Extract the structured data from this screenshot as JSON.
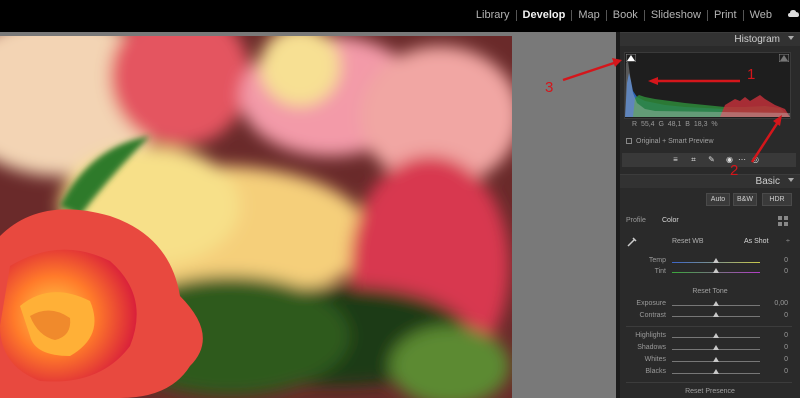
{
  "modules": [
    "Library",
    "Develop",
    "Map",
    "Book",
    "Slideshow",
    "Print",
    "Web"
  ],
  "active_module": "Develop",
  "panels": {
    "histogram": {
      "title": "Histogram",
      "readout": "R  55,4  G  48,1  B  18,3  %",
      "preview": "Original + Smart Preview"
    },
    "basic": {
      "title": "Basic",
      "treatment": [
        "Auto",
        "B&W",
        "HDR"
      ],
      "profile_label": "Profile",
      "profile_value": "Color",
      "wb_label": "Reset WB",
      "wb_value": "As Shot",
      "tone_label": "Reset Tone",
      "presence_label": "Reset Presence",
      "sliders": [
        {
          "label": "Temp",
          "value": "0"
        },
        {
          "label": "Tint",
          "value": "0"
        },
        {
          "label": "Exposure",
          "value": "0,00"
        },
        {
          "label": "Contrast",
          "value": "0"
        },
        {
          "label": "Highlights",
          "value": "0"
        },
        {
          "label": "Shadows",
          "value": "0"
        },
        {
          "label": "Whites",
          "value": "0"
        },
        {
          "label": "Blacks",
          "value": "0"
        }
      ]
    }
  },
  "annotations": [
    "1",
    "2",
    "3"
  ],
  "colors": {
    "accent": "#d4161b",
    "panel": "#2a2a2a"
  }
}
